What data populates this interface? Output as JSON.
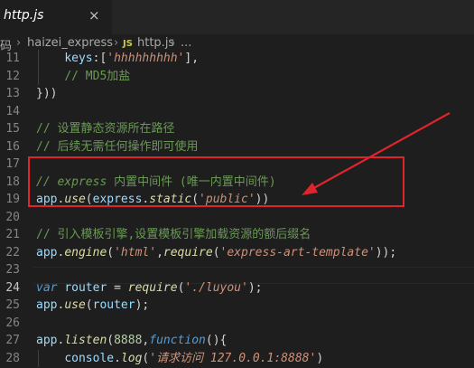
{
  "tab": {
    "title": "http.js",
    "close_glyph": "×"
  },
  "breadcrumb": {
    "root": "码",
    "folder": "haizei_express",
    "file_icon": "JS",
    "file": "http.js",
    "more": "..."
  },
  "lines": [
    {
      "n": "11",
      "tokens": [
        [
          "pun",
          "    "
        ],
        [
          "var",
          "keys"
        ],
        [
          "pun",
          ":["
        ],
        [
          "str",
          "'hhhhhhhhh'"
        ],
        [
          "pun",
          "],"
        ]
      ]
    },
    {
      "n": "12",
      "tokens": [
        [
          "pun",
          "    "
        ],
        [
          "cmt",
          "// MD5加盐"
        ]
      ]
    },
    {
      "n": "13",
      "tokens": [
        [
          "pun",
          "}))"
        ]
      ]
    },
    {
      "n": "14",
      "tokens": []
    },
    {
      "n": "15",
      "tokens": [
        [
          "cmt",
          "// 设置静态资源所在路径"
        ]
      ]
    },
    {
      "n": "16",
      "tokens": [
        [
          "cmt",
          "// 后续无需任何操作即可使用"
        ]
      ]
    },
    {
      "n": "17",
      "tokens": []
    },
    {
      "n": "18",
      "tokens": [
        [
          "cmtit",
          "// express "
        ],
        [
          "cmt",
          "内置中间件 (唯一内置中间件)"
        ]
      ]
    },
    {
      "n": "19",
      "tokens": [
        [
          "var",
          "app"
        ],
        [
          "pun",
          "."
        ],
        [
          "fn",
          "use"
        ],
        [
          "pun",
          "("
        ],
        [
          "var",
          "express"
        ],
        [
          "pun",
          "."
        ],
        [
          "fn",
          "static"
        ],
        [
          "pun",
          "("
        ],
        [
          "str",
          "'public'"
        ],
        [
          "pun",
          "))"
        ]
      ]
    },
    {
      "n": "20",
      "tokens": []
    },
    {
      "n": "21",
      "tokens": [
        [
          "cmt",
          "// 引入模板引擎,设置模板引擎加载资源的额后缀名"
        ]
      ]
    },
    {
      "n": "22",
      "tokens": [
        [
          "var",
          "app"
        ],
        [
          "pun",
          "."
        ],
        [
          "fn",
          "engine"
        ],
        [
          "pun",
          "("
        ],
        [
          "str",
          "'html'"
        ],
        [
          "pun",
          ","
        ],
        [
          "fn",
          "require"
        ],
        [
          "pun",
          "("
        ],
        [
          "str",
          "'express-art-template'"
        ],
        [
          "pun",
          "));"
        ]
      ]
    },
    {
      "n": "23",
      "tokens": []
    },
    {
      "n": "24",
      "active": true,
      "tokens": [
        [
          "kw",
          "var"
        ],
        [
          "pun",
          " "
        ],
        [
          "var",
          "router"
        ],
        [
          "pun",
          " = "
        ],
        [
          "fn",
          "require"
        ],
        [
          "pun",
          "("
        ],
        [
          "str",
          "'./luyou'"
        ],
        [
          "pun",
          ");"
        ]
      ]
    },
    {
      "n": "25",
      "tokens": [
        [
          "var",
          "app"
        ],
        [
          "pun",
          "."
        ],
        [
          "fn",
          "use"
        ],
        [
          "pun",
          "("
        ],
        [
          "var",
          "router"
        ],
        [
          "pun",
          ");"
        ]
      ]
    },
    {
      "n": "26",
      "tokens": []
    },
    {
      "n": "27",
      "tokens": [
        [
          "var",
          "app"
        ],
        [
          "pun",
          "."
        ],
        [
          "fn",
          "listen"
        ],
        [
          "pun",
          "("
        ],
        [
          "num",
          "8888"
        ],
        [
          "pun",
          ","
        ],
        [
          "kw",
          "function"
        ],
        [
          "pun",
          "(){"
        ]
      ]
    },
    {
      "n": "28",
      "tokens": [
        [
          "pun",
          "    "
        ],
        [
          "var",
          "console"
        ],
        [
          "pun",
          "."
        ],
        [
          "fn",
          "log"
        ],
        [
          "pun",
          "("
        ],
        [
          "str",
          "'请求访问 127.0.0.1:8888'"
        ],
        [
          "pun",
          ")"
        ]
      ]
    }
  ],
  "colors": {
    "editor_bg": "#1e1e1e",
    "tab_bg": "#252526",
    "annotation_red": "#e0242b",
    "comment": "#6a9955",
    "string": "#ce9178",
    "function": "#dcdcaa",
    "variable": "#9cdcfe",
    "keyword": "#569cd6",
    "number": "#b5cea8"
  },
  "annotation": {
    "box": "highlight lines 21-22",
    "arrow": "red arrow pointing to highlighted lines"
  }
}
